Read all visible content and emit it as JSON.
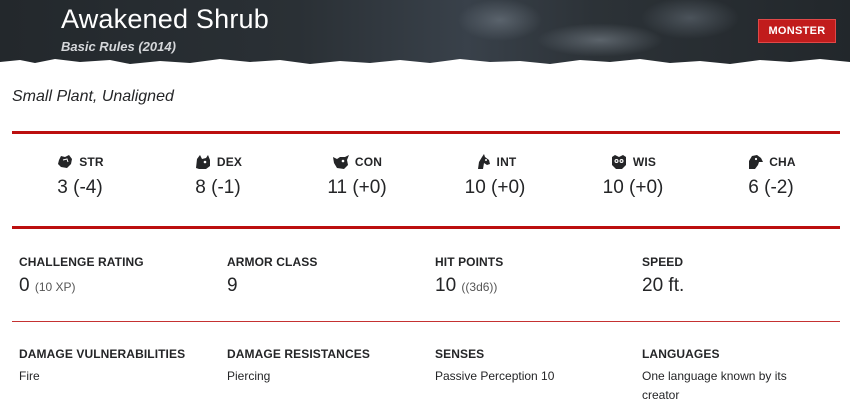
{
  "header": {
    "title": "Awakened Shrub",
    "source": "Basic Rules (2014)",
    "badge": "MONSTER"
  },
  "meta": "Small Plant, Unaligned",
  "abilities": [
    {
      "name": "STR",
      "score": "3 (-4)",
      "icon": "fist-icon"
    },
    {
      "name": "DEX",
      "score": "8 (-1)",
      "icon": "cat-head-icon"
    },
    {
      "name": "CON",
      "score": "11 (+0)",
      "icon": "bull-head-icon"
    },
    {
      "name": "INT",
      "score": "10 (+0)",
      "icon": "horse-head-icon"
    },
    {
      "name": "WIS",
      "score": "10 (+0)",
      "icon": "owl-head-icon"
    },
    {
      "name": "CHA",
      "score": "6 (-2)",
      "icon": "eagle-head-icon"
    }
  ],
  "stats": {
    "challenge": {
      "label": "CHALLENGE RATING",
      "value": "0",
      "sub": "(10 XP)"
    },
    "armor": {
      "label": "ARMOR CLASS",
      "value": "9"
    },
    "hp": {
      "label": "HIT POINTS",
      "value": "10",
      "sub": "((3d6))"
    },
    "speed": {
      "label": "SPEED",
      "value": "20 ft."
    }
  },
  "properties": {
    "vulnerabilities": {
      "label": "DAMAGE VULNERABILITIES",
      "value": "Fire"
    },
    "resistances": {
      "label": "DAMAGE RESISTANCES",
      "value": "Piercing"
    },
    "senses": {
      "label": "SENSES",
      "value": "Passive Perception 10"
    },
    "languages": {
      "label": "LANGUAGES",
      "value": "One language known by its creator"
    }
  },
  "colors": {
    "accent": "#bc0f0f",
    "badge": "#c11c1c",
    "header": "#2a3035"
  }
}
